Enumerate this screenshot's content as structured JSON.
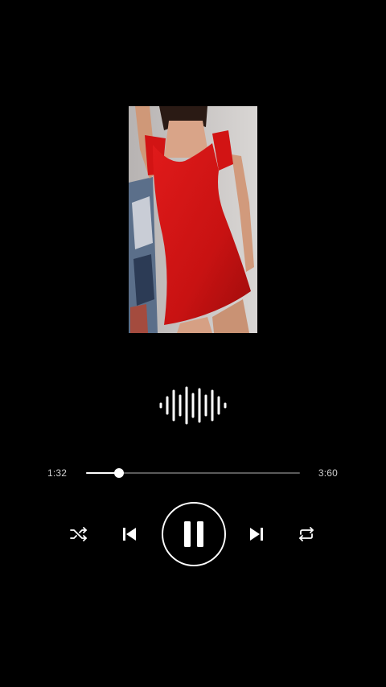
{
  "player": {
    "elapsed": "1:32",
    "total": "3:60",
    "progress": 0.155,
    "state": "playing"
  },
  "artwork": {
    "description_icon": "album-art-photo"
  },
  "controls": {
    "shuffle_icon": "shuffle-icon",
    "previous_icon": "skip-previous-icon",
    "pause_icon": "pause-icon",
    "next_icon": "skip-next-icon",
    "repeat_icon": "repeat-icon"
  },
  "colors": {
    "background": "#000000",
    "foreground": "#ffffff",
    "track": "#5a5a5a",
    "dress": "#d81818"
  }
}
